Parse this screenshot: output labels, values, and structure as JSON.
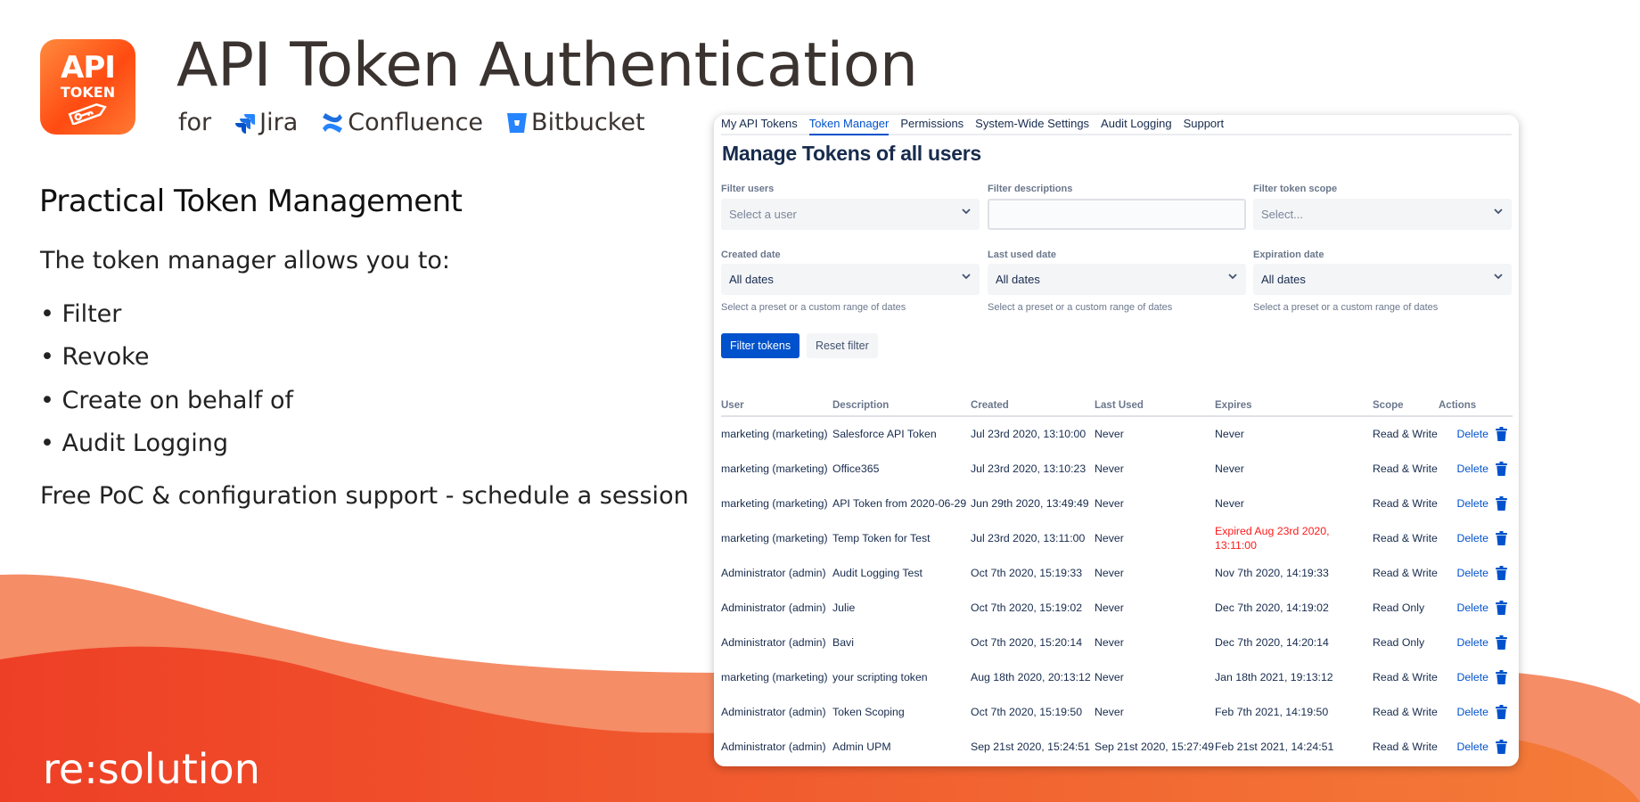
{
  "header": {
    "logo": {
      "line1": "API",
      "line2": "TOKEN"
    },
    "title": "API Token Authentication",
    "for_label": "for",
    "products": [
      {
        "name": "Jira",
        "icon": "jira-icon",
        "color": "#2684ff"
      },
      {
        "name": "Confluence",
        "icon": "confluence-icon",
        "color": "#2684ff"
      },
      {
        "name": "Bitbucket",
        "icon": "bitbucket-icon",
        "color": "#2684ff"
      }
    ]
  },
  "left": {
    "heading": "Practical Token Management",
    "intro": "The token manager allows you to:",
    "bullets": [
      "• Filter",
      "• Revoke",
      "• Create on behalf of",
      "• Audit Logging"
    ],
    "support": "Free PoC & configuration support - schedule a session",
    "brand": "re:solution"
  },
  "colors": {
    "accent": "#0052cc",
    "wave_light": "#f58d67",
    "wave_dark_start": "#ee3f26",
    "wave_dark_end": "#f47c38",
    "expired": "#ff1a1a"
  },
  "app": {
    "tabs": [
      {
        "label": "My API Tokens"
      },
      {
        "label": "Token Manager",
        "active": true
      },
      {
        "label": "Permissions"
      },
      {
        "label": "System-Wide Settings"
      },
      {
        "label": "Audit Logging"
      },
      {
        "label": "Support"
      }
    ],
    "page_title": "Manage Tokens of all users",
    "filters": {
      "users": {
        "label": "Filter users",
        "placeholder": "Select a user"
      },
      "descriptions": {
        "label": "Filter descriptions",
        "value": ""
      },
      "scope": {
        "label": "Filter token scope",
        "placeholder": "Select..."
      },
      "created": {
        "label": "Created date",
        "value": "All dates",
        "help": "Select a preset or a custom range of dates"
      },
      "last_used": {
        "label": "Last used date",
        "value": "All dates",
        "help": "Select a preset or a custom range of dates"
      },
      "expiration": {
        "label": "Expiration date",
        "value": "All dates",
        "help": "Select a preset or a custom range of dates"
      }
    },
    "buttons": {
      "filter": "Filter tokens",
      "reset": "Reset filter"
    },
    "table": {
      "columns": [
        "User",
        "Description",
        "Created",
        "Last Used",
        "Expires",
        "Scope",
        "Actions"
      ],
      "delete_label": "Delete",
      "rows": [
        {
          "user": "marketing (marketing)",
          "description": "Salesforce API Token",
          "created": "Jul 23rd 2020, 13:10:00",
          "last_used": "Never",
          "expires": "Never",
          "scope": "Read & Write"
        },
        {
          "user": "marketing (marketing)",
          "description": "Office365",
          "created": "Jul 23rd 2020, 13:10:23",
          "last_used": "Never",
          "expires": "Never",
          "scope": "Read & Write"
        },
        {
          "user": "marketing (marketing)",
          "description": "API Token from 2020-06-29",
          "created": "Jun 29th 2020, 13:49:49",
          "last_used": "Never",
          "expires": "Never",
          "scope": "Read & Write"
        },
        {
          "user": "marketing (marketing)",
          "description": "Temp Token for Test",
          "created": "Jul 23rd 2020, 13:11:00",
          "last_used": "Never",
          "expires": "Expired Aug 23rd 2020, 13:11:00",
          "expired": true,
          "scope": "Read & Write"
        },
        {
          "user": "Administrator (admin)",
          "description": "Audit Logging Test",
          "created": "Oct 7th 2020, 15:19:33",
          "last_used": "Never",
          "expires": "Nov 7th 2020, 14:19:33",
          "scope": "Read & Write"
        },
        {
          "user": "Administrator (admin)",
          "description": "Julie",
          "created": "Oct 7th 2020, 15:19:02",
          "last_used": "Never",
          "expires": "Dec 7th 2020, 14:19:02",
          "scope": "Read Only"
        },
        {
          "user": "Administrator (admin)",
          "description": "Bavi",
          "created": "Oct 7th 2020, 15:20:14",
          "last_used": "Never",
          "expires": "Dec 7th 2020, 14:20:14",
          "scope": "Read Only"
        },
        {
          "user": "marketing (marketing)",
          "description": "your scripting token",
          "created": "Aug 18th 2020, 20:13:12",
          "last_used": "Never",
          "expires": "Jan 18th 2021, 19:13:12",
          "scope": "Read & Write"
        },
        {
          "user": "Administrator (admin)",
          "description": "Token Scoping",
          "created": "Oct 7th 2020, 15:19:50",
          "last_used": "Never",
          "expires": "Feb 7th 2021, 14:19:50",
          "scope": "Read & Write"
        },
        {
          "user": "Administrator (admin)",
          "description": "Admin UPM",
          "created": "Sep 21st 2020, 15:24:51",
          "last_used": "Sep 21st 2020, 15:27:49",
          "expires": "Feb 21st 2021, 14:24:51",
          "scope": "Read & Write"
        }
      ]
    }
  }
}
